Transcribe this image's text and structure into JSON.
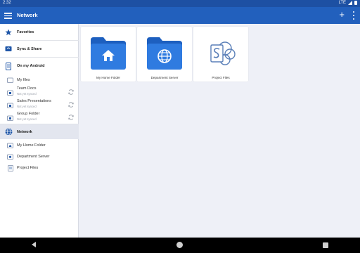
{
  "status_bar": {
    "time": "2:32",
    "network": "LTE"
  },
  "app_bar": {
    "title": "Network",
    "add_label": "+"
  },
  "sidebar": {
    "favorites": "Favorites",
    "sync_share": "Sync & Share",
    "on_device": "On my Android",
    "my_files": "My files",
    "synced_folders": [
      {
        "label": "Team Docs",
        "status": "Not yet synced"
      },
      {
        "label": "Sales Presentations",
        "status": "Not yet synced"
      },
      {
        "label": "Group Folder",
        "status": "Not yet synced"
      }
    ],
    "network": "Network",
    "network_items": [
      "My Home Folder",
      "Department Server",
      "Project Files"
    ]
  },
  "main": {
    "cards": [
      {
        "label": "My Home Folder",
        "icon": "home-folder-icon"
      },
      {
        "label": "Department Server",
        "icon": "globe-folder-icon"
      },
      {
        "label": "Project Files",
        "icon": "sharepoint-icon"
      }
    ]
  },
  "colors": {
    "app_bar": "#2260bd",
    "status_bar": "#1d50a3",
    "folder": "#2f7be0",
    "folder_tab": "#1d5fbf",
    "background": "#eef0f7"
  }
}
